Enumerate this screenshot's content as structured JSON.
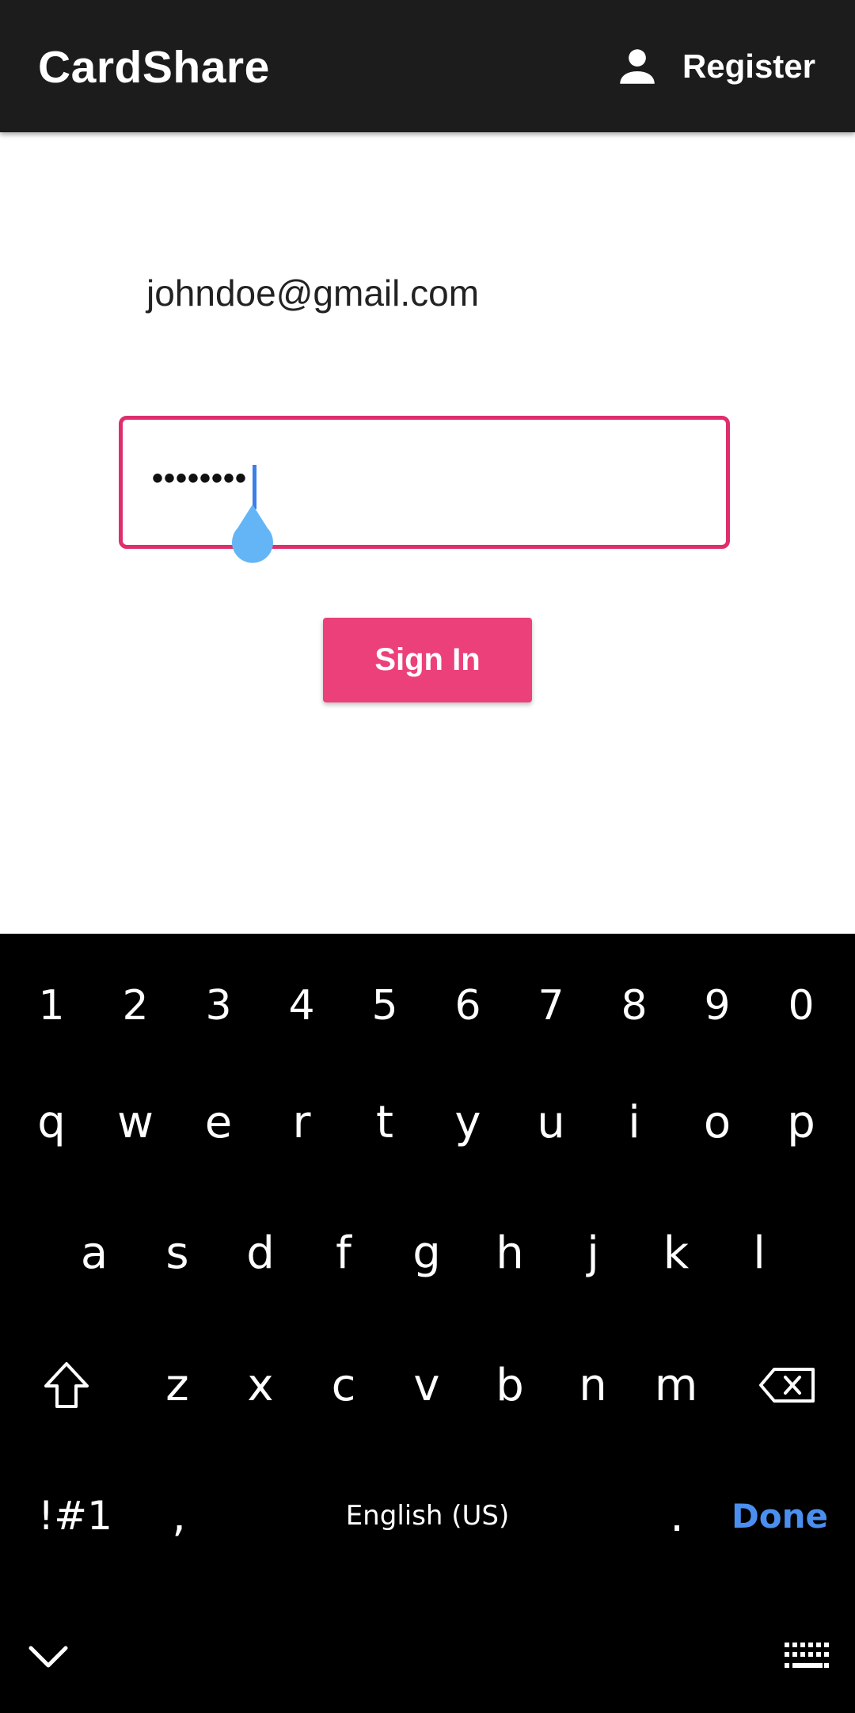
{
  "app_bar": {
    "title": "CardShare",
    "register_label": "Register",
    "register_icon": "person-icon"
  },
  "form": {
    "email_value": "johndoe@gmail.com",
    "password_value": "••••••••",
    "signin_label": "Sign In"
  },
  "colors": {
    "accent": "#ec407a",
    "field_border": "#de2f6d",
    "cursor": "#3d7ee8",
    "cursor_handle": "#64b5f6",
    "appbar_bg": "#1c1c1c",
    "keyboard_bg": "#000000",
    "done_color": "#4a8ff0"
  },
  "keyboard": {
    "numbers": [
      "1",
      "2",
      "3",
      "4",
      "5",
      "6",
      "7",
      "8",
      "9",
      "0"
    ],
    "row1": [
      "q",
      "w",
      "e",
      "r",
      "t",
      "y",
      "u",
      "i",
      "o",
      "p"
    ],
    "row2": [
      "a",
      "s",
      "d",
      "f",
      "g",
      "h",
      "j",
      "k",
      "l"
    ],
    "row3": [
      "z",
      "x",
      "c",
      "v",
      "b",
      "n",
      "m"
    ],
    "symbols_label": "!#1",
    "comma_label": ",",
    "language_label": "English (US)",
    "period_label": ".",
    "done_label": "Done"
  }
}
